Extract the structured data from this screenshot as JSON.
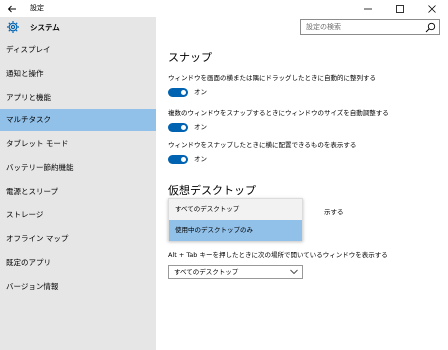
{
  "window": {
    "title": "設定"
  },
  "header": {
    "title": "システム"
  },
  "search": {
    "placeholder": "設定の検索"
  },
  "sidebar": {
    "items": [
      {
        "label": "ディスプレイ"
      },
      {
        "label": "通知と操作"
      },
      {
        "label": "アプリと機能"
      },
      {
        "label": "マルチタスク",
        "active": true
      },
      {
        "label": "タブレット モード"
      },
      {
        "label": "バッテリー節約機能"
      },
      {
        "label": "電源とスリープ"
      },
      {
        "label": "ストレージ"
      },
      {
        "label": "オフライン マップ"
      },
      {
        "label": "既定のアプリ"
      },
      {
        "label": "バージョン情報"
      }
    ]
  },
  "snap": {
    "title": "スナップ",
    "settings": [
      {
        "description": "ウィンドウを画面の横または隅にドラッグしたときに自動的に整列する",
        "state": "オン",
        "on": true
      },
      {
        "description": "複数のウィンドウをスナップするときにウィンドウのサイズを自動調整する",
        "state": "オン",
        "on": true
      },
      {
        "description": "ウィンドウをスナップしたときに横に配置できるものを表示する",
        "state": "オン",
        "on": true
      }
    ]
  },
  "virtual_desktops": {
    "title": "仮想デスクトップ",
    "partial_text": "示する",
    "dropdown_options": [
      {
        "label": "すべてのデスクトップ"
      },
      {
        "label": "使用中のデスクトップのみ",
        "selected": true
      }
    ],
    "alt_tab_label": "Alt + Tab キーを押したときに次の場所で開いているウィンドウを表示する",
    "alt_tab_value": "すべてのデスクトップ"
  },
  "colors": {
    "accent": "#0063b1",
    "selected": "#91c0e9",
    "sidebar": "#e6e6e6"
  }
}
